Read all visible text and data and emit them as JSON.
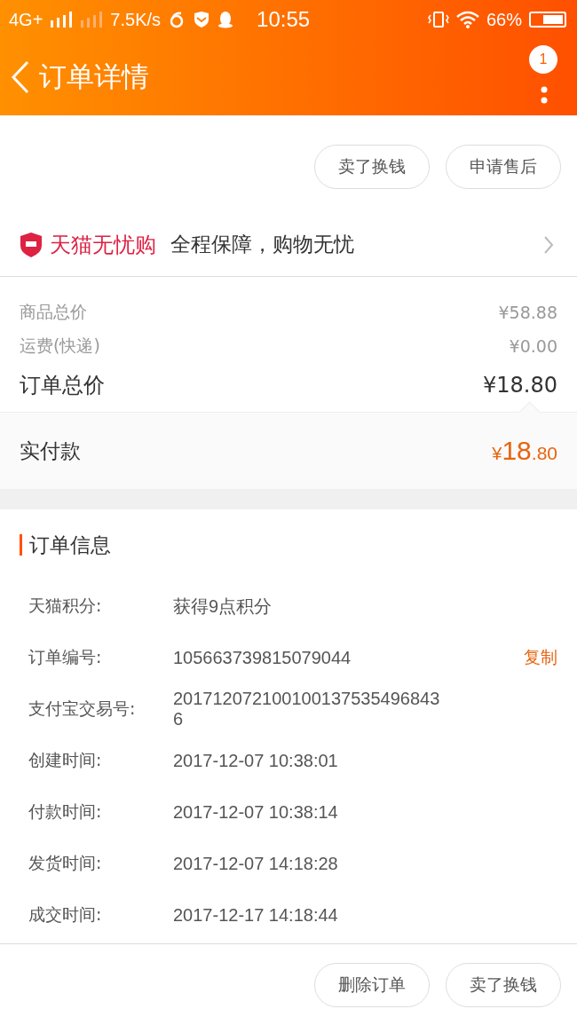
{
  "status_bar": {
    "network": "4G+",
    "speed": "7.5K/s",
    "time": "10:55",
    "battery": "66%"
  },
  "header": {
    "title": "订单详情",
    "badge": "1"
  },
  "top_actions": [
    "卖了换钱",
    "申请售后"
  ],
  "guarantee": {
    "brand": "天猫无忧购",
    "text": "全程保障，购物无忧"
  },
  "prices": [
    {
      "label": "商品总价",
      "value": "¥58.88",
      "kind": "minor"
    },
    {
      "label": "运费(快递)",
      "value": "¥0.00",
      "kind": "minor"
    },
    {
      "label": "订单总价",
      "value": "¥18.80",
      "kind": "total"
    }
  ],
  "paid": {
    "label": "实付款",
    "value": "¥18.80"
  },
  "order_info": {
    "title": "订单信息",
    "rows": [
      {
        "label": "天猫积分:",
        "value": "获得9点积分"
      },
      {
        "label": "订单编号:",
        "value": "105663739815079044",
        "action": "复制"
      },
      {
        "label": "支付宝交易号:",
        "value": "2017120721001001375354968436"
      },
      {
        "label": "创建时间:",
        "value": "2017-12-07 10:38:01"
      },
      {
        "label": "付款时间:",
        "value": "2017-12-07 10:38:14"
      },
      {
        "label": "发货时间:",
        "value": "2017-12-07 14:18:28"
      },
      {
        "label": "成交时间:",
        "value": "2017-12-17 14:18:44"
      }
    ]
  },
  "bottom_actions": [
    "删除订单",
    "卖了换钱"
  ]
}
